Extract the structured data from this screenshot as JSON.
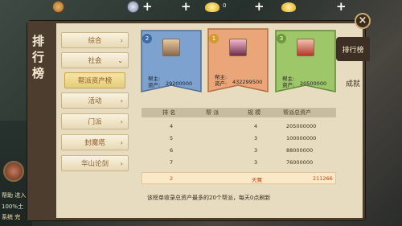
{
  "resources": [
    {
      "name": "copper-coin",
      "value": "",
      "color": "#c98b3c"
    },
    {
      "name": "silver-coin",
      "value": "",
      "color": "#9aa7c0"
    },
    {
      "name": "gold-ingot",
      "value": "0",
      "color": "#f0c23a"
    },
    {
      "name": "gold-ingot-2",
      "value": "",
      "color": "#f0c23a"
    }
  ],
  "title": {
    "chars": [
      "排",
      "行",
      "榜"
    ]
  },
  "menu": [
    {
      "label": "综合",
      "arrow": "›"
    },
    {
      "label": "社会",
      "arrow": "⌄"
    },
    {
      "label": "帮派资产榜",
      "arrow": ""
    },
    {
      "label": "活动",
      "arrow": "›"
    },
    {
      "label": "门派",
      "arrow": "›"
    },
    {
      "label": "封魔塔",
      "arrow": "›"
    },
    {
      "label": "华山论剑",
      "arrow": "›"
    }
  ],
  "right_tabs": [
    {
      "label": "排行榜"
    },
    {
      "label": "成就"
    }
  ],
  "top3": [
    {
      "rank": "2",
      "leader_label": "帮主:",
      "asset_label": "资产:",
      "asset": "29200000",
      "color": "#7ea2cf"
    },
    {
      "rank": "1",
      "leader_label": "帮主:",
      "asset_label": "资产:",
      "asset": "432299500",
      "color": "#e7a271"
    },
    {
      "rank": "3",
      "leader_label": "帮主:",
      "asset_label": "资产:",
      "asset": "20500000",
      "color": "#9ec76a"
    }
  ],
  "table": {
    "headers": [
      "排 名",
      "帮 派",
      "规 模",
      "帮派总资产"
    ],
    "rows": [
      [
        "4",
        "",
        "4",
        "205000000"
      ],
      [
        "5",
        "",
        "3",
        "100000000"
      ],
      [
        "6",
        "",
        "3",
        "88000000"
      ],
      [
        "7",
        "",
        "3",
        "76000000"
      ]
    ],
    "my_row": [
      "2",
      "天賈",
      "3",
      "211266"
    ]
  },
  "note": "该榜单收录总资产最多的20个帮派，每天0点刷新",
  "side": {
    "labels": [
      "帮助 进入",
      "100%土",
      "系统 完"
    ]
  }
}
